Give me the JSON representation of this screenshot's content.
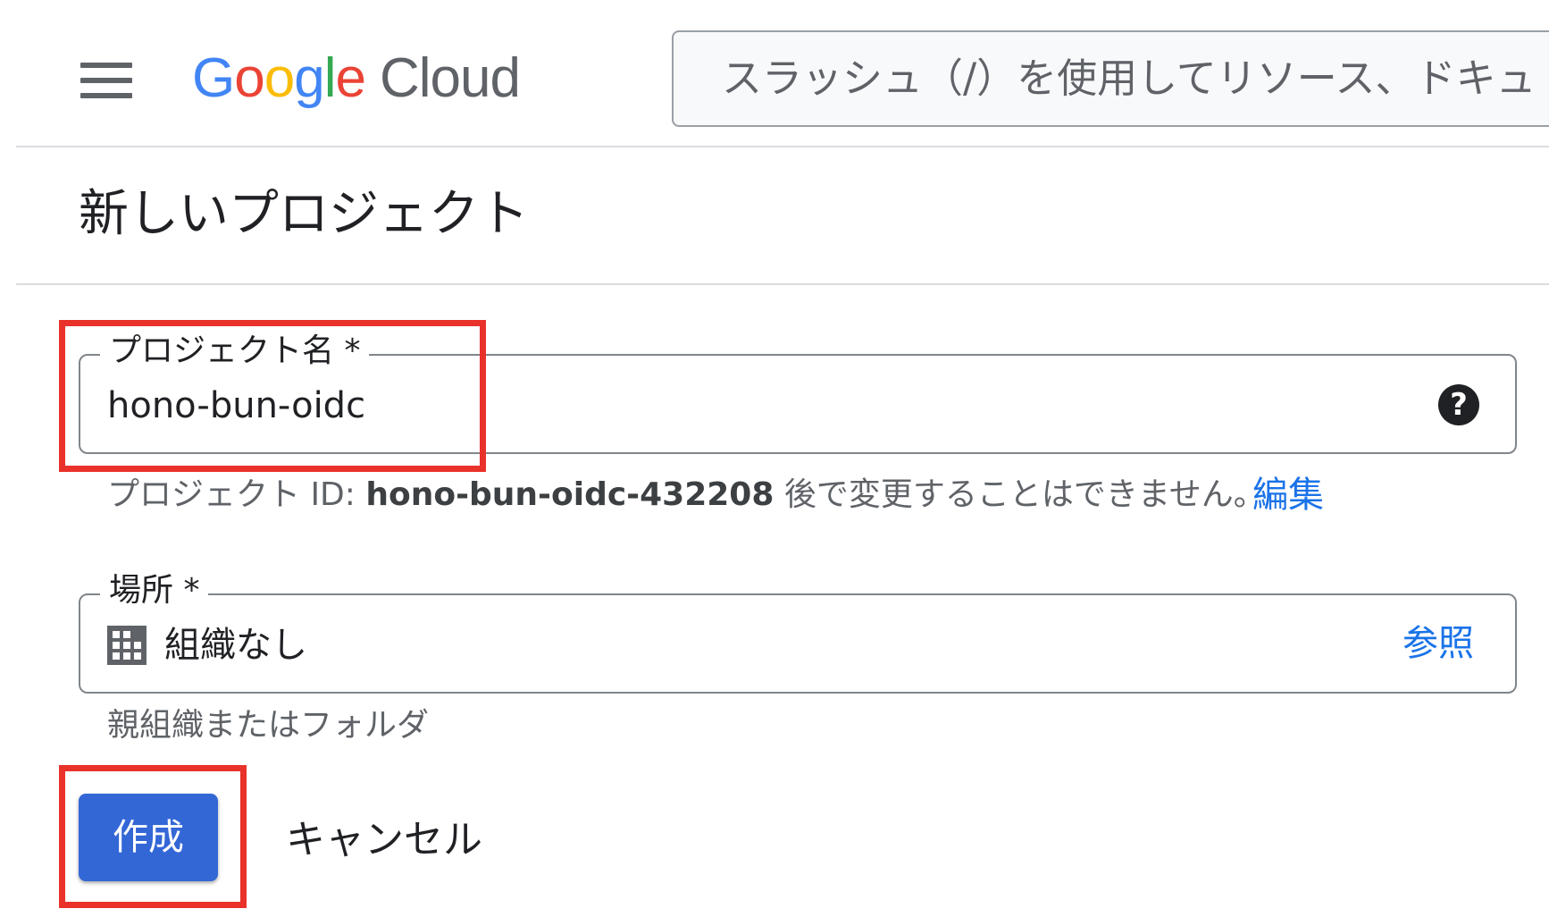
{
  "header": {
    "menu_icon": "hamburger-menu-icon",
    "logo": {
      "google_letters": [
        {
          "char": "G",
          "color": "#4285f4"
        },
        {
          "char": "o",
          "color": "#ea4335"
        },
        {
          "char": "o",
          "color": "#fbbc05"
        },
        {
          "char": "g",
          "color": "#4285f4"
        },
        {
          "char": "l",
          "color": "#34a853"
        },
        {
          "char": "e",
          "color": "#ea4335"
        }
      ],
      "cloud": "Cloud"
    },
    "search_placeholder": "スラッシュ（/）を使用してリソース、ドキュ"
  },
  "page": {
    "title": "新しいプロジェクト"
  },
  "project_name": {
    "label": "プロジェクト名 *",
    "value": "hono-bun-oidc",
    "help_icon": "help-circle-icon"
  },
  "project_id_hint": {
    "prefix": "プロジェクト ID: ",
    "id": "hono-bun-oidc-432208",
    "suffix": " 後で変更することはできません。",
    "edit_label": "編集"
  },
  "location": {
    "label": "場所 *",
    "value": "組織なし",
    "icon": "building-icon",
    "browse_label": "参照",
    "hint": "親組織またはフォルダ"
  },
  "actions": {
    "create_label": "作成",
    "cancel_label": "キャンセル"
  },
  "colors": {
    "primary_button": "#3367d6",
    "link": "#1a73e8",
    "highlight": "#e8322a"
  }
}
